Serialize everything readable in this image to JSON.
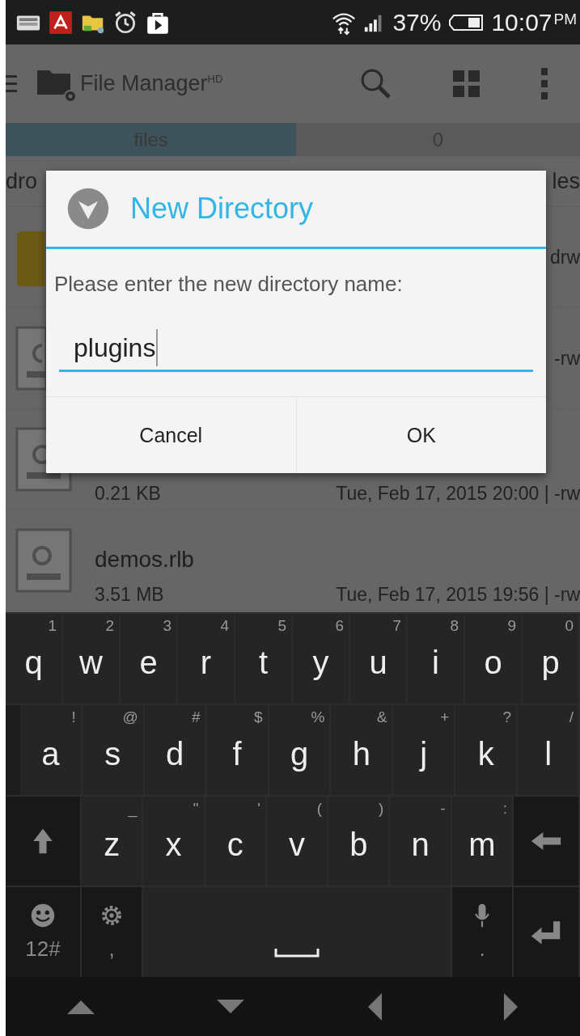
{
  "status_bar": {
    "battery": "37%",
    "time": "10:07",
    "ampm": "PM"
  },
  "app_bar": {
    "title": "File Manager$^{HD}$"
  },
  "tabs": [
    {
      "label": "files",
      "selected": true
    },
    {
      "label": "0",
      "selected": false
    }
  ],
  "path_bar": {
    "left": "dro",
    "right": "les"
  },
  "files": [
    {
      "kind": "folder",
      "right": "drw"
    },
    {
      "kind": "file",
      "right": "-rw"
    },
    {
      "kind": "file",
      "size": "0.21 KB",
      "date": "Tue, Feb 17, 2015 20:00 | -rw"
    },
    {
      "kind": "file",
      "name": "demos.rlb",
      "size": "3.51 MB",
      "date": "Tue, Feb 17, 2015 19:56 | -rw"
    }
  ],
  "dialog": {
    "title": "New Directory",
    "message": "Please enter the new directory name:",
    "value": "plugins",
    "buttons": [
      "Cancel",
      "OK"
    ]
  },
  "keyboard": {
    "rows": [
      {
        "keys": [
          {
            "kind": "letter",
            "label": "q",
            "hint": "1"
          },
          {
            "kind": "letter",
            "label": "w",
            "hint": "2"
          },
          {
            "kind": "letter",
            "label": "e",
            "hint": "3"
          },
          {
            "kind": "letter",
            "label": "r",
            "hint": "4"
          },
          {
            "kind": "letter",
            "label": "t",
            "hint": "5"
          },
          {
            "kind": "letter",
            "label": "y",
            "hint": "6"
          },
          {
            "kind": "letter",
            "label": "u",
            "hint": "7"
          },
          {
            "kind": "letter",
            "label": "i",
            "hint": "8"
          },
          {
            "kind": "letter",
            "label": "o",
            "hint": "9"
          },
          {
            "kind": "letter",
            "label": "p",
            "hint": "0"
          }
        ]
      },
      {
        "keys": [
          {
            "kind": "letter",
            "label": "a",
            "hint": "!"
          },
          {
            "kind": "letter",
            "label": "s",
            "hint": "@"
          },
          {
            "kind": "letter",
            "label": "d",
            "hint": "#"
          },
          {
            "kind": "letter",
            "label": "f",
            "hint": "$"
          },
          {
            "kind": "letter",
            "label": "g",
            "hint": "%"
          },
          {
            "kind": "letter",
            "label": "h",
            "hint": "&"
          },
          {
            "kind": "letter",
            "label": "j",
            "hint": "+"
          },
          {
            "kind": "letter",
            "label": "k",
            "hint": "?"
          },
          {
            "kind": "letter",
            "label": "l",
            "hint": "/"
          }
        ]
      },
      {
        "keys": [
          {
            "kind": "shift"
          },
          {
            "kind": "letter",
            "label": "z",
            "hint": "_"
          },
          {
            "kind": "letter",
            "label": "x",
            "hint": "\""
          },
          {
            "kind": "letter",
            "label": "c",
            "hint": "'"
          },
          {
            "kind": "letter",
            "label": "v",
            "hint": "("
          },
          {
            "kind": "letter",
            "label": "b",
            "hint": ")"
          },
          {
            "kind": "letter",
            "label": "n",
            "hint": "-"
          },
          {
            "kind": "letter",
            "label": "m",
            "hint": ":"
          },
          {
            "kind": "backspace"
          }
        ]
      },
      {
        "keys": [
          {
            "kind": "emoji",
            "label": "12#"
          },
          {
            "kind": "settings",
            "label": ","
          },
          {
            "kind": "space"
          },
          {
            "kind": "mic",
            "label": "."
          },
          {
            "kind": "enter"
          }
        ]
      }
    ]
  }
}
